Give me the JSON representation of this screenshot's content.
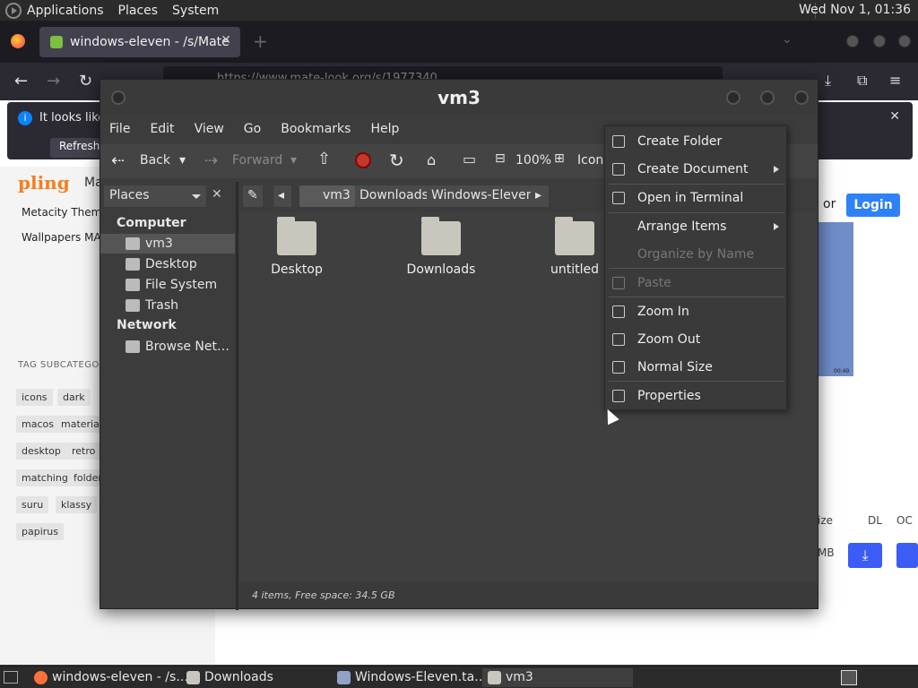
{
  "top_panel": {
    "menus": [
      "Applications",
      "Places",
      "System"
    ],
    "clock": "Wed Nov 1, 01:36"
  },
  "browser": {
    "tab_title": "windows-eleven - /s/Mate",
    "url": "https://www.mate-look.org/s/1977340",
    "notice_text": "It looks like",
    "notice_button": "Refresh Fi",
    "page": {
      "brand": "pling",
      "ma": "Ma",
      "links": [
        "Metacity Theme",
        "Wallpapers MA"
      ],
      "tag_title": "TAG SUBCATEGORI",
      "tags": [
        "icons",
        "dark",
        "macos",
        "material",
        "desktop",
        "retro",
        "matching",
        "folders",
        "suru",
        "klassy",
        "papirus"
      ],
      "or": "or",
      "login": "Login",
      "col_size": "ize",
      "col_dl": "DL",
      "col_oc": "OC",
      "mb": "MB",
      "preview_time": "00:49"
    }
  },
  "file_manager": {
    "title": "vm3",
    "menus": [
      "File",
      "Edit",
      "View",
      "Go",
      "Bookmarks",
      "Help"
    ],
    "toolbar": {
      "back": "Back",
      "forward": "Forward",
      "zoom": "100%",
      "view": "Icon"
    },
    "places_label": "Places",
    "breadcrumbs": [
      "vm3",
      "Downloads",
      "Windows-Eleven"
    ],
    "sidebar": {
      "computer_heading": "Computer",
      "computer_items": [
        "vm3",
        "Desktop",
        "File System",
        "Trash"
      ],
      "network_heading": "Network",
      "network_items": [
        "Browse Net…"
      ]
    },
    "files": [
      "Desktop",
      "Downloads",
      "untitled"
    ],
    "status": "4 items, Free space: 34.5 GB"
  },
  "context_menu": {
    "items": [
      {
        "label": "Create Folder",
        "enabled": true,
        "submenu": false
      },
      {
        "label": "Create Document",
        "enabled": true,
        "submenu": true
      },
      {
        "label": "Open in Terminal",
        "enabled": true,
        "submenu": false
      },
      {
        "label": "Arrange Items",
        "enabled": true,
        "submenu": true
      },
      {
        "label": "Organize by Name",
        "enabled": false,
        "submenu": false
      },
      {
        "label": "Paste",
        "enabled": false,
        "submenu": false
      },
      {
        "label": "Zoom In",
        "enabled": true,
        "submenu": false
      },
      {
        "label": "Zoom Out",
        "enabled": true,
        "submenu": false
      },
      {
        "label": "Normal Size",
        "enabled": true,
        "submenu": false
      },
      {
        "label": "Properties",
        "enabled": true,
        "submenu": false
      }
    ]
  },
  "taskbar": {
    "items": [
      "windows-eleven - /s…",
      "Downloads",
      "Windows-Eleven.ta…",
      "vm3"
    ]
  }
}
